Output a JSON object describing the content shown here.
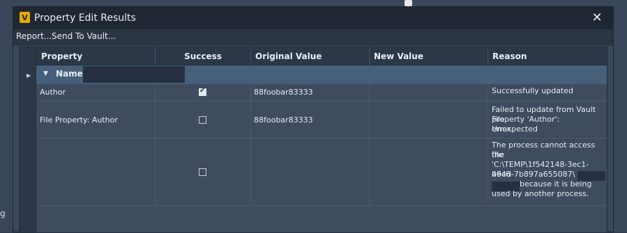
{
  "background": {
    "left_glyph": "g"
  },
  "dialog": {
    "title": "Property Edit Results",
    "icon_letter": "V",
    "close_glyph": "✕"
  },
  "menu": {
    "items": [
      "Report...",
      "Send To Vault..."
    ]
  },
  "grid": {
    "columns": [
      "Property",
      "Success",
      "Original Value",
      "New Value",
      "Reason"
    ],
    "group": {
      "label": "Name:"
    },
    "rows": [
      {
        "property": "Author",
        "success": true,
        "original": "88foobar83333",
        "new": "",
        "reason": [
          "Successfully updated"
        ]
      },
      {
        "property": "File Property: Author",
        "success": false,
        "original": "88foobar83333",
        "new": "",
        "reason": [
          "Failed to update from Vault File",
          "property 'Author':  Unexpected",
          "error."
        ]
      },
      {
        "property": "",
        "success": false,
        "original": "",
        "new": "",
        "reason": [
          "The process cannot access the",
          "file",
          "'C:\\TEMP\\1f542148-3ec1-46c6-",
          "b94d-7b897a655087\\",
          " because it is being",
          "used by another process."
        ]
      }
    ]
  },
  "colors": {
    "titlebar": "#1f2732",
    "group_row": "#466079",
    "grid_bg": "#3f4b5e"
  }
}
